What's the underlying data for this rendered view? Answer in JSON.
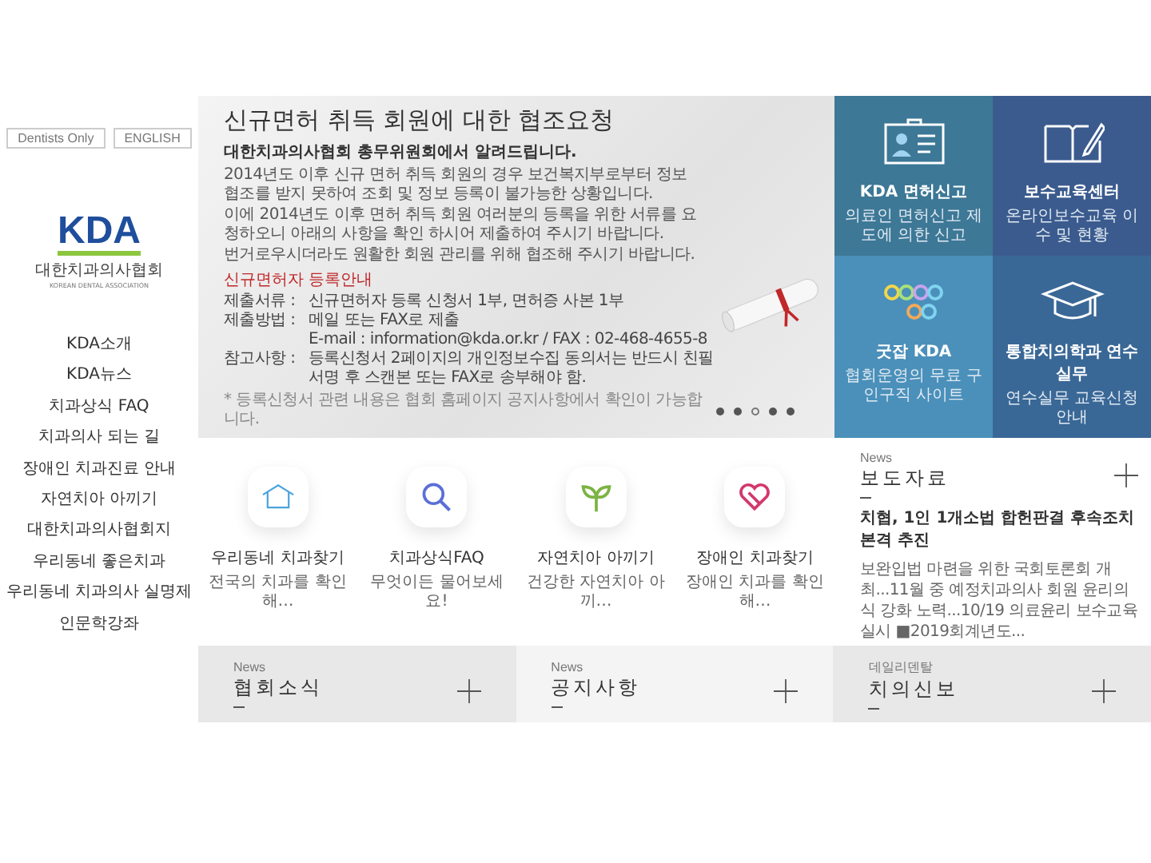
{
  "top_links": [
    {
      "label": "Dentists Only"
    },
    {
      "label": "ENGLISH"
    }
  ],
  "logo": {
    "mark": "KDA",
    "name": "대한치과의사협회",
    "subtitle": "KOREAN DENTAL ASSOCIATION"
  },
  "sidebar": {
    "items": [
      {
        "label": "KDA소개"
      },
      {
        "label": "KDA뉴스"
      },
      {
        "label": "치과상식 FAQ"
      },
      {
        "label": "치과의사 되는 길"
      },
      {
        "label": "장애인 치과진료 안내"
      },
      {
        "label": "자연치아 아끼기"
      },
      {
        "label": "대한치과의사협회지"
      },
      {
        "label": "우리동네 좋은치과"
      },
      {
        "label": "우리동네 치과의사 실명제"
      },
      {
        "label": "인문학강좌"
      }
    ]
  },
  "banner": {
    "title": "신규면허 취득 회원에 대한 협조요청",
    "subtitle": "대한치과의사협회 총무위원회에서 알려드립니다.",
    "paragraphs": [
      "2014년도 이후 신규 면허 취득 회원의 경우 보건복지부로부터 정보 협조를 받지 못하여 조회 및 정보 등록이 불가능한 상황입니다.",
      "이에 2014년도 이후 면허 취득 회원 여러분의 등록을 위한 서류를 요청하오니 아래의 사항을 확인 하시어 제출하여 주시기 바랍니다.",
      "번거로우시더라도 원활한 회원 관리를 위해 협조해 주시기 바랍니다."
    ],
    "notice_heading": "신규면허자 등록안내",
    "details": [
      {
        "label": "제출서류 :",
        "value": "신규면허자 등록 신청서 1부, 면허증 사본 1부"
      },
      {
        "label": "제출방법 :",
        "value": "메일 또는 FAX로 제출"
      },
      {
        "value": "E-mail : information@kda.or.kr / FAX : 02-468-4655-8"
      },
      {
        "label": "참고사항 :",
        "value": "등록신청서 2페이지의 개인정보수집 동의서는 반드시 친필 서명 후 스캔본 또는 FAX로 송부해야 함."
      }
    ],
    "footnote": "* 등록신청서 관련 내용은 협회 홈페이지 공지사항에서 확인이 가능합니다.",
    "slides": [
      {
        "selected": false
      },
      {
        "selected": false
      },
      {
        "selected": true
      },
      {
        "selected": false
      },
      {
        "selected": false
      }
    ]
  },
  "tiles": [
    {
      "kind": "license",
      "title": "KDA 면허신고",
      "caption": "의료인 면허신고 제도에 의한 신고",
      "color": "#3d7896"
    },
    {
      "kind": "book",
      "title": "보수교육센터",
      "caption": "온라인보수교육 이수 및 현황",
      "color": "#3b5b8e"
    },
    {
      "kind": "goodjob",
      "title": "굿잡 KDA",
      "caption": "협회운영의 무료 구인구직 사이트",
      "color": "#4a90ba"
    },
    {
      "kind": "cap",
      "title": "통합치의학과 연수실무",
      "caption": "연수실무 교육신청 안내",
      "color": "#3a6896"
    }
  ],
  "quick_links": [
    {
      "kind": "house",
      "title": "우리동네 치과찾기",
      "caption": "전국의 치과를 확인해…"
    },
    {
      "kind": "search",
      "title": "치과상식FAQ",
      "caption": "무엇이든 물어보세요!"
    },
    {
      "kind": "sprout",
      "title": "자연치아 아끼기",
      "caption": "건강한 자연치아 아끼…"
    },
    {
      "kind": "heart",
      "title": "장애인 치과찾기",
      "caption": "장애인 치과를 확인해…"
    }
  ],
  "press": {
    "label": "News",
    "title": "보도자료",
    "headline": "치협, 1인 1개소법 합헌판결 후속조치 본격 추진",
    "summary": "보완입법 마련을 위한 국회토론회 개최...11월 중 예정치과의사 회원 윤리의식 강화 노력...10/19 의료윤리 보수교육 실시 ■2019회계년도..."
  },
  "news_panels": [
    {
      "label": "News",
      "title": "협회소식"
    },
    {
      "label": "News",
      "title": "공지사항"
    },
    {
      "label": "데일리덴탈",
      "title": "치의신보"
    }
  ]
}
